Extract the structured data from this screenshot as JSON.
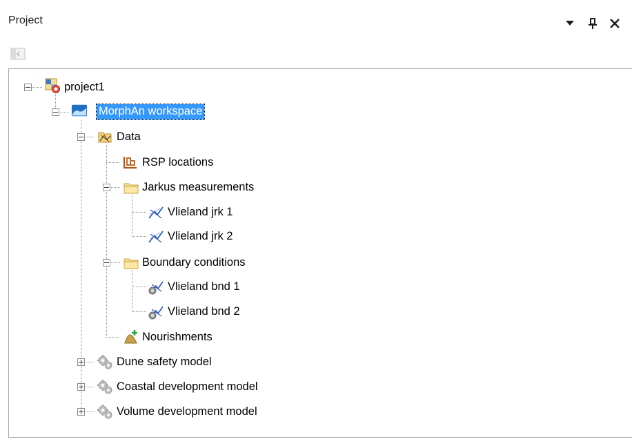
{
  "panel": {
    "title": "Project",
    "controls": [
      {
        "name": "dropdown-arrow-icon",
        "glyph": "▼"
      },
      {
        "name": "pin-icon",
        "glyph": "⊥"
      },
      {
        "name": "close-icon",
        "glyph": "✕"
      }
    ]
  },
  "toolbar": {
    "buttons": [
      {
        "name": "toggle-panel-icon",
        "enabled": false
      }
    ]
  },
  "tree": {
    "nodes": [
      {
        "id": "project1",
        "label": "project1",
        "icon": "project-icon",
        "expanded": true
      },
      {
        "id": "workspace",
        "label": "MorphAn workspace",
        "icon": "workspace-icon",
        "expanded": true,
        "selected": true
      },
      {
        "id": "data",
        "label": "Data",
        "icon": "data-icon",
        "expanded": true
      },
      {
        "id": "rsp",
        "label": "RSP locations",
        "icon": "rsp-locations-icon"
      },
      {
        "id": "jarkus",
        "label": "Jarkus measurements",
        "icon": "folder-icon",
        "expanded": true
      },
      {
        "id": "jrk1",
        "label": "Vlieland jrk 1",
        "icon": "transect-icon"
      },
      {
        "id": "jrk2",
        "label": "Vlieland jrk 2",
        "icon": "transect-icon"
      },
      {
        "id": "boundary",
        "label": "Boundary conditions",
        "icon": "folder-icon",
        "expanded": true
      },
      {
        "id": "bnd1",
        "label": "Vlieland bnd 1",
        "icon": "boundary-icon"
      },
      {
        "id": "bnd2",
        "label": "Vlieland bnd 2",
        "icon": "boundary-icon"
      },
      {
        "id": "nourish",
        "label": "Nourishments",
        "icon": "nourishment-icon"
      },
      {
        "id": "dune",
        "label": "Dune safety model",
        "icon": "gear-icon",
        "expanded": false
      },
      {
        "id": "coastal",
        "label": "Coastal development model",
        "icon": "gear-icon",
        "expanded": false
      },
      {
        "id": "volume",
        "label": "Volume development model",
        "icon": "gear-icon",
        "expanded": false
      }
    ]
  },
  "colors": {
    "selection": "#3399ff",
    "folder": "#f5d57a",
    "gear": "#b8b8b8",
    "border": "#a7a7a7"
  }
}
